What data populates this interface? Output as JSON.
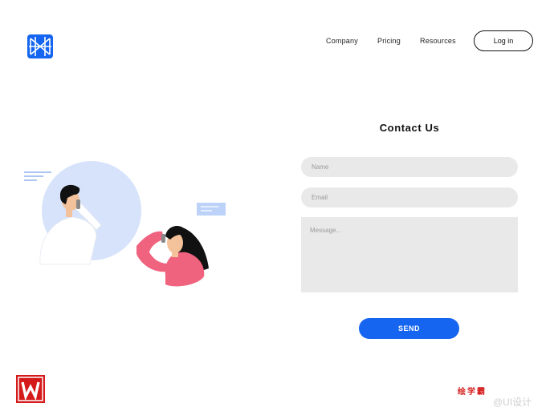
{
  "colors": {
    "accent": "#1565f0",
    "field_bg": "#e9e9e9",
    "illustration_blue": "#d6e3fb",
    "shirt_pink": "#f0637f",
    "watermark_red": "#d51a1a"
  },
  "icons": {
    "logo": "geometric-blue-logo-icon",
    "watermark": "red-w-logo-icon"
  },
  "nav": {
    "items": [
      "Company",
      "Pricing",
      "Resources"
    ],
    "login_label": "Log in"
  },
  "form": {
    "title": "Contact Us",
    "name_placeholder": "Name",
    "email_placeholder": "Email",
    "message_placeholder": "Message...",
    "send_label": "SEND"
  },
  "watermark": {
    "red_text": "绘学霸",
    "gray_text": "@UI设计"
  }
}
